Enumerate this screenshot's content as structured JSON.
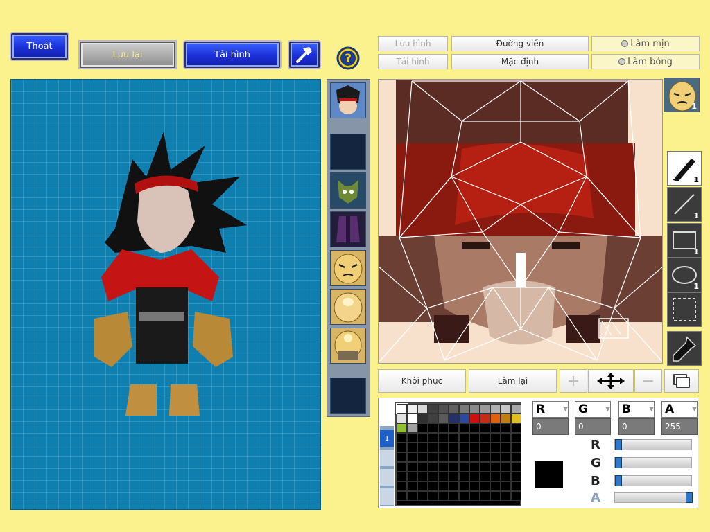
{
  "toolbar": {
    "exit_label": "Thoát",
    "save_label": "Lưu lại",
    "reload_label": "Tải hình"
  },
  "editor_top": {
    "save_image_label": "Lưu hình",
    "load_image_label": "Tải hình",
    "outline_label": "Đường viền",
    "default_label": "Mặc định",
    "smooth_label": "Làm mịn",
    "shade_label": "Làm bóng"
  },
  "editor_bottom": {
    "restore_label": "Khôi phục",
    "redo_label": "Làm lại"
  },
  "tools": {
    "pen_count": "1",
    "line_count": "1",
    "rect_count": "1",
    "ellipse_count": "1",
    "preview_count": "1"
  },
  "color": {
    "r_label": "R",
    "g_label": "G",
    "b_label": "B",
    "a_label": "A",
    "r": "0",
    "g": "0",
    "b": "0",
    "a": "255",
    "current_hex": "#000000",
    "r_fraction": 0,
    "g_fraction": 0,
    "b_fraction": 0,
    "a_fraction": 1
  },
  "palette_tab_label": "1",
  "palette": [
    "#ffffff",
    "#f0f0f0",
    "#d8d8d8",
    "#404040",
    "#505050",
    "#606060",
    "#7a7a7a",
    "#8a8a8a",
    "#9a9a9a",
    "#b0b0b0",
    "#c6c6c6",
    "#a8a8a8",
    "#e2e2e2",
    "#ffffff",
    "#303030",
    "#404040",
    "#5a5a5a",
    "#24306a",
    "#2a4aa0",
    "#cc1010",
    "#cc2a10",
    "#e06010",
    "#c08010",
    "#e0c020",
    "#90c030",
    "#a0a0a0"
  ]
}
